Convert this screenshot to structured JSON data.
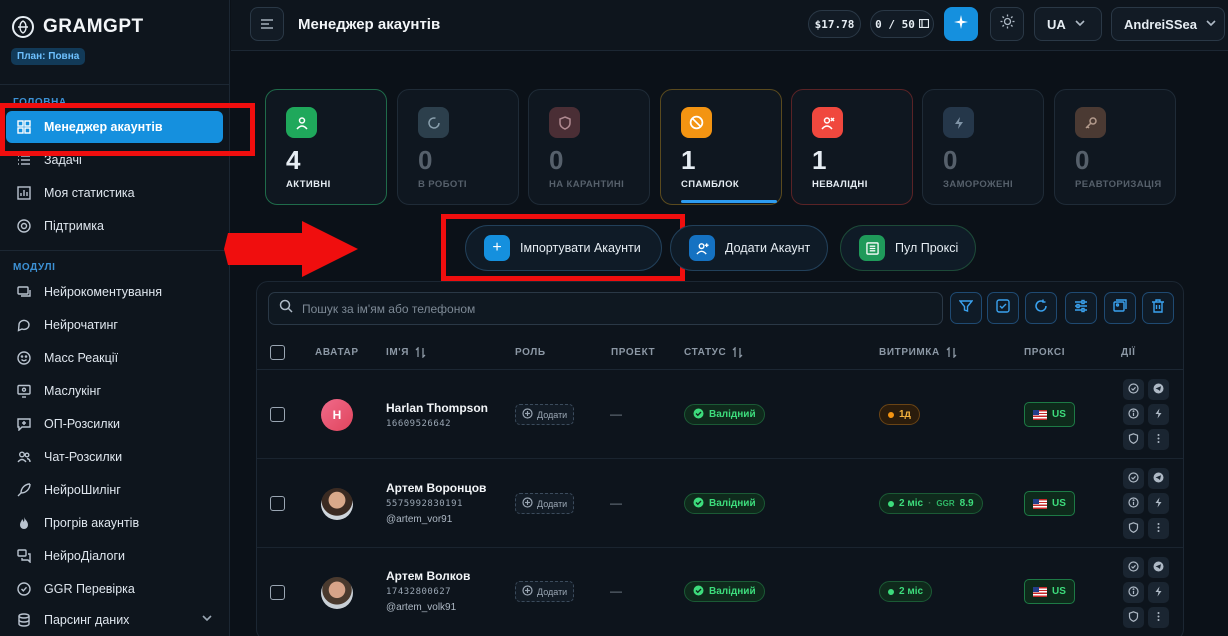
{
  "sidebar": {
    "logo": "GRAMGPT",
    "plan": "План: Повна",
    "section_main": "ГОЛОВНА",
    "section_modules": "МОДУЛІ",
    "main_items": [
      {
        "label": "Менеджер акаунтів",
        "icon": "grid-icon",
        "active": true
      },
      {
        "label": "Задачі",
        "icon": "tasks-icon"
      },
      {
        "label": "Моя статистика",
        "icon": "chart-icon"
      },
      {
        "label": "Підтримка",
        "icon": "lifebuoy-icon"
      }
    ],
    "module_items": [
      {
        "label": "Нейрокоментування",
        "icon": "comments-icon"
      },
      {
        "label": "Нейрочатинг",
        "icon": "chat-icon"
      },
      {
        "label": "Масс Реакції",
        "icon": "smile-icon"
      },
      {
        "label": "Маслукінг",
        "icon": "monitor-eye-icon"
      },
      {
        "label": "ОП-Розсилки",
        "icon": "message-plus-icon"
      },
      {
        "label": "Чат-Розсилки",
        "icon": "users-icon"
      },
      {
        "label": "НейроШилінг",
        "icon": "rocket-icon"
      },
      {
        "label": "Прогрів акаунтів",
        "icon": "flame-icon"
      },
      {
        "label": "НейроДіалоги",
        "icon": "dialog-icon"
      },
      {
        "label": "GGR Перевірка",
        "icon": "badge-check-icon"
      },
      {
        "label": "Парсинг даних",
        "icon": "database-icon"
      }
    ]
  },
  "header": {
    "title": "Менеджер акаунтів",
    "balance": "$17.78",
    "quota": "0 / 50",
    "language": "UA",
    "user": "AndreiSSea"
  },
  "stats": [
    {
      "value": "4",
      "label": "АКТИВНІ",
      "color": "#1fa85b",
      "icon": "user-icon"
    },
    {
      "value": "0",
      "label": "В РОБОТІ",
      "color": "#2c3f4c",
      "icon": "refresh-icon"
    },
    {
      "value": "0",
      "label": "НА КАРАНТИНІ",
      "color": "#4a2e35",
      "icon": "shield-icon"
    },
    {
      "value": "1",
      "label": "СПАМБЛОК",
      "color": "#f39412",
      "icon": "ban-icon"
    },
    {
      "value": "1",
      "label": "НЕВАЛІДНІ",
      "color": "#f0483e",
      "icon": "user-x-icon"
    },
    {
      "value": "0",
      "label": "ЗАМОРОЖЕНІ",
      "color": "#25374a",
      "icon": "bolt-icon"
    },
    {
      "value": "0",
      "label": "РЕАВТОРИЗАЦІЯ",
      "color": "#4b3a33",
      "icon": "key-icon"
    }
  ],
  "actions": {
    "import": "Імпортувати Акаунти",
    "add": "Додати Акаунт",
    "proxy": "Пул Проксі"
  },
  "search": {
    "placeholder": "Пошук за ім'ям або телефоном"
  },
  "table": {
    "headers": {
      "avatar": "АВАТАР",
      "name": "ІМ'Я",
      "role": "РОЛЬ",
      "project": "ПРОЕКТ",
      "status": "СТАТУС",
      "vitrymka": "ВИТРИМКА",
      "proxy": "ПРОКСІ",
      "actions": "ДІЇ"
    },
    "rows": [
      {
        "name": "Harlan Thompson",
        "phone": "16609526642",
        "username": "",
        "avatar_letter": "H",
        "role": "Додати",
        "project": "—",
        "status": "Валідний",
        "vitrymka": "1д",
        "ggr_label": "",
        "ggr": "",
        "proxy": "US"
      },
      {
        "name": "Артем Воронцов",
        "phone": "5575992830191",
        "username": "@artem_vor91",
        "avatar_letter": "",
        "role": "Додати",
        "project": "—",
        "status": "Валідний",
        "vitrymka": "2 міс",
        "ggr_label": "GGR",
        "ggr": "8.9",
        "proxy": "US"
      },
      {
        "name": "Артем Волков",
        "phone": "17432800627",
        "username": "@artem_volk91",
        "avatar_letter": "",
        "role": "Додати",
        "project": "—",
        "status": "Валідний",
        "vitrymka": "2 міс",
        "ggr_label": "",
        "ggr": "",
        "proxy": "US"
      }
    ]
  }
}
